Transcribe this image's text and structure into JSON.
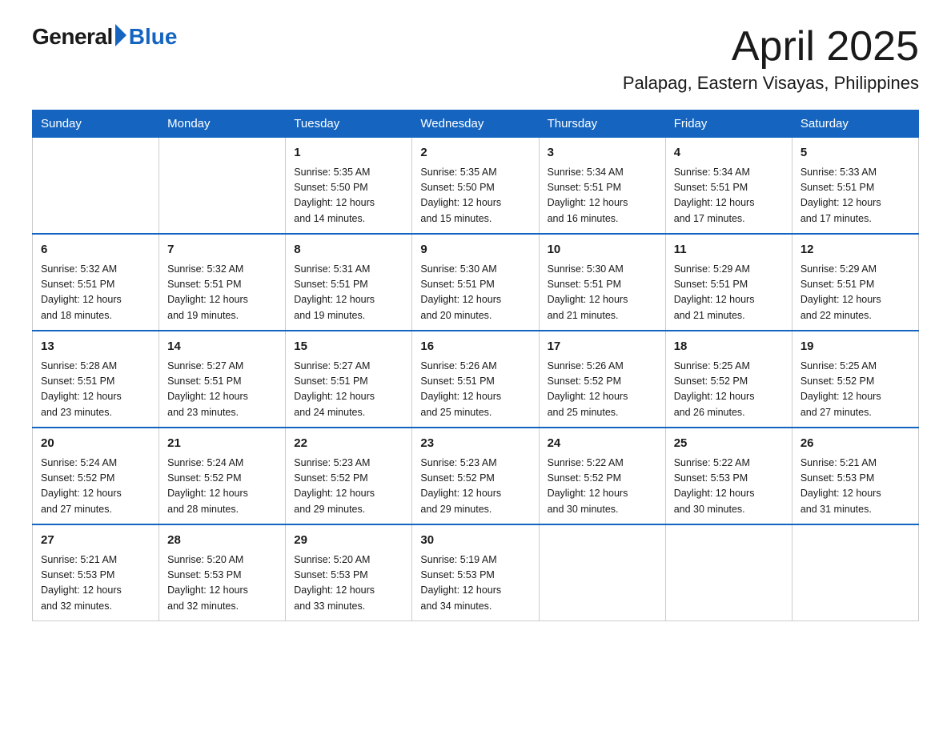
{
  "logo": {
    "general": "General",
    "blue": "Blue"
  },
  "header": {
    "month_year": "April 2025",
    "location": "Palapag, Eastern Visayas, Philippines"
  },
  "days_of_week": [
    "Sunday",
    "Monday",
    "Tuesday",
    "Wednesday",
    "Thursday",
    "Friday",
    "Saturday"
  ],
  "weeks": [
    [
      {
        "day": "",
        "info": ""
      },
      {
        "day": "",
        "info": ""
      },
      {
        "day": "1",
        "info": "Sunrise: 5:35 AM\nSunset: 5:50 PM\nDaylight: 12 hours\nand 14 minutes."
      },
      {
        "day": "2",
        "info": "Sunrise: 5:35 AM\nSunset: 5:50 PM\nDaylight: 12 hours\nand 15 minutes."
      },
      {
        "day": "3",
        "info": "Sunrise: 5:34 AM\nSunset: 5:51 PM\nDaylight: 12 hours\nand 16 minutes."
      },
      {
        "day": "4",
        "info": "Sunrise: 5:34 AM\nSunset: 5:51 PM\nDaylight: 12 hours\nand 17 minutes."
      },
      {
        "day": "5",
        "info": "Sunrise: 5:33 AM\nSunset: 5:51 PM\nDaylight: 12 hours\nand 17 minutes."
      }
    ],
    [
      {
        "day": "6",
        "info": "Sunrise: 5:32 AM\nSunset: 5:51 PM\nDaylight: 12 hours\nand 18 minutes."
      },
      {
        "day": "7",
        "info": "Sunrise: 5:32 AM\nSunset: 5:51 PM\nDaylight: 12 hours\nand 19 minutes."
      },
      {
        "day": "8",
        "info": "Sunrise: 5:31 AM\nSunset: 5:51 PM\nDaylight: 12 hours\nand 19 minutes."
      },
      {
        "day": "9",
        "info": "Sunrise: 5:30 AM\nSunset: 5:51 PM\nDaylight: 12 hours\nand 20 minutes."
      },
      {
        "day": "10",
        "info": "Sunrise: 5:30 AM\nSunset: 5:51 PM\nDaylight: 12 hours\nand 21 minutes."
      },
      {
        "day": "11",
        "info": "Sunrise: 5:29 AM\nSunset: 5:51 PM\nDaylight: 12 hours\nand 21 minutes."
      },
      {
        "day": "12",
        "info": "Sunrise: 5:29 AM\nSunset: 5:51 PM\nDaylight: 12 hours\nand 22 minutes."
      }
    ],
    [
      {
        "day": "13",
        "info": "Sunrise: 5:28 AM\nSunset: 5:51 PM\nDaylight: 12 hours\nand 23 minutes."
      },
      {
        "day": "14",
        "info": "Sunrise: 5:27 AM\nSunset: 5:51 PM\nDaylight: 12 hours\nand 23 minutes."
      },
      {
        "day": "15",
        "info": "Sunrise: 5:27 AM\nSunset: 5:51 PM\nDaylight: 12 hours\nand 24 minutes."
      },
      {
        "day": "16",
        "info": "Sunrise: 5:26 AM\nSunset: 5:51 PM\nDaylight: 12 hours\nand 25 minutes."
      },
      {
        "day": "17",
        "info": "Sunrise: 5:26 AM\nSunset: 5:52 PM\nDaylight: 12 hours\nand 25 minutes."
      },
      {
        "day": "18",
        "info": "Sunrise: 5:25 AM\nSunset: 5:52 PM\nDaylight: 12 hours\nand 26 minutes."
      },
      {
        "day": "19",
        "info": "Sunrise: 5:25 AM\nSunset: 5:52 PM\nDaylight: 12 hours\nand 27 minutes."
      }
    ],
    [
      {
        "day": "20",
        "info": "Sunrise: 5:24 AM\nSunset: 5:52 PM\nDaylight: 12 hours\nand 27 minutes."
      },
      {
        "day": "21",
        "info": "Sunrise: 5:24 AM\nSunset: 5:52 PM\nDaylight: 12 hours\nand 28 minutes."
      },
      {
        "day": "22",
        "info": "Sunrise: 5:23 AM\nSunset: 5:52 PM\nDaylight: 12 hours\nand 29 minutes."
      },
      {
        "day": "23",
        "info": "Sunrise: 5:23 AM\nSunset: 5:52 PM\nDaylight: 12 hours\nand 29 minutes."
      },
      {
        "day": "24",
        "info": "Sunrise: 5:22 AM\nSunset: 5:52 PM\nDaylight: 12 hours\nand 30 minutes."
      },
      {
        "day": "25",
        "info": "Sunrise: 5:22 AM\nSunset: 5:53 PM\nDaylight: 12 hours\nand 30 minutes."
      },
      {
        "day": "26",
        "info": "Sunrise: 5:21 AM\nSunset: 5:53 PM\nDaylight: 12 hours\nand 31 minutes."
      }
    ],
    [
      {
        "day": "27",
        "info": "Sunrise: 5:21 AM\nSunset: 5:53 PM\nDaylight: 12 hours\nand 32 minutes."
      },
      {
        "day": "28",
        "info": "Sunrise: 5:20 AM\nSunset: 5:53 PM\nDaylight: 12 hours\nand 32 minutes."
      },
      {
        "day": "29",
        "info": "Sunrise: 5:20 AM\nSunset: 5:53 PM\nDaylight: 12 hours\nand 33 minutes."
      },
      {
        "day": "30",
        "info": "Sunrise: 5:19 AM\nSunset: 5:53 PM\nDaylight: 12 hours\nand 34 minutes."
      },
      {
        "day": "",
        "info": ""
      },
      {
        "day": "",
        "info": ""
      },
      {
        "day": "",
        "info": ""
      }
    ]
  ]
}
